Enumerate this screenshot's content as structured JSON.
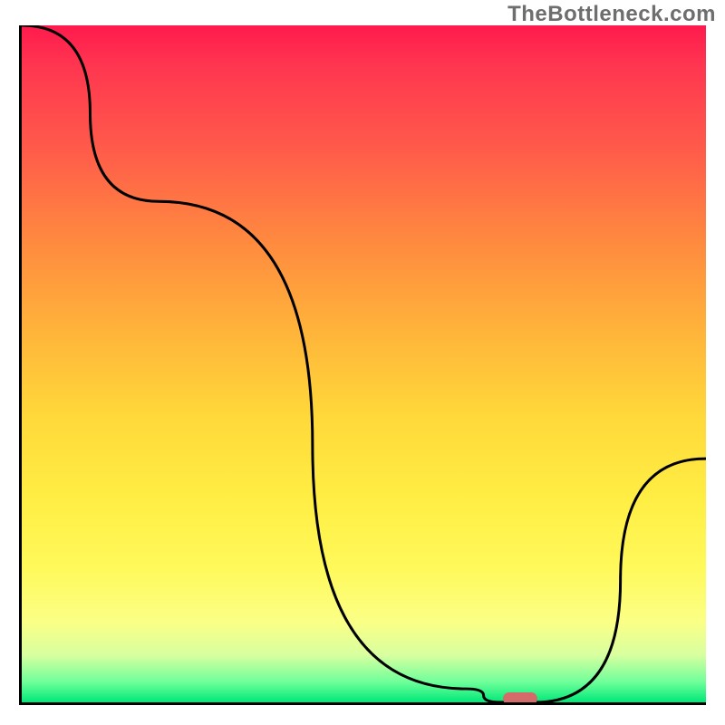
{
  "watermark": "TheBottleneck.com",
  "chart_data": {
    "type": "line",
    "title": "",
    "xlabel": "",
    "ylabel": "",
    "xlim": [
      0,
      100
    ],
    "ylim": [
      0,
      100
    ],
    "grid": false,
    "series": [
      {
        "name": "curve",
        "x": [
          0,
          20,
          65,
          70,
          75,
          100
        ],
        "values": [
          100,
          74,
          2,
          0,
          0,
          36
        ]
      }
    ],
    "marker": {
      "x": 72.5,
      "y": 0,
      "shape": "rounded-bar",
      "color": "#d46a6a"
    },
    "background_gradient": {
      "stops": [
        {
          "pos": 0.0,
          "color": "#ff1a4d"
        },
        {
          "pos": 0.06,
          "color": "#ff3650"
        },
        {
          "pos": 0.18,
          "color": "#ff5a4a"
        },
        {
          "pos": 0.32,
          "color": "#ff8a3f"
        },
        {
          "pos": 0.46,
          "color": "#ffb63a"
        },
        {
          "pos": 0.58,
          "color": "#ffd93a"
        },
        {
          "pos": 0.7,
          "color": "#ffee44"
        },
        {
          "pos": 0.8,
          "color": "#fff95a"
        },
        {
          "pos": 0.88,
          "color": "#fbff85"
        },
        {
          "pos": 0.93,
          "color": "#d8ffa0"
        },
        {
          "pos": 0.97,
          "color": "#6fff9a"
        },
        {
          "pos": 1.0,
          "color": "#00e878"
        }
      ]
    }
  }
}
